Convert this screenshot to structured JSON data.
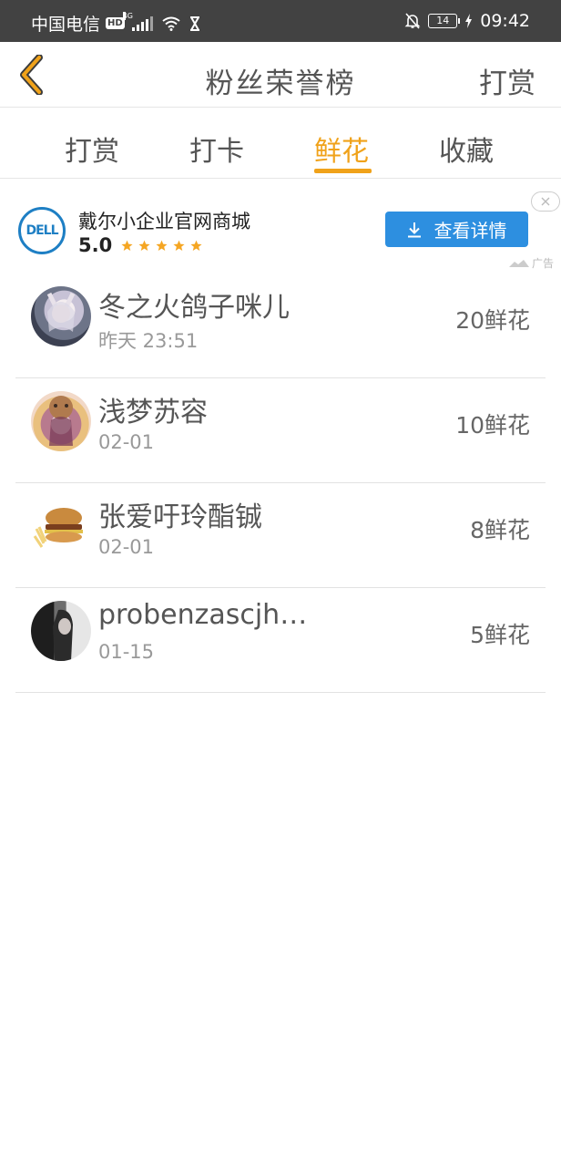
{
  "status_bar": {
    "carrier": "中国电信",
    "hd": "HD",
    "network": "4G",
    "battery": "14",
    "time": "09:42"
  },
  "header": {
    "title": "粉丝荣誉榜",
    "right_action": "打赏"
  },
  "tabs": [
    {
      "label": "打赏",
      "active": false
    },
    {
      "label": "打卡",
      "active": false
    },
    {
      "label": "鲜花",
      "active": true
    },
    {
      "label": "收藏",
      "active": false
    }
  ],
  "ad": {
    "logo_text": "DELL",
    "title": "戴尔小企业官网商城",
    "rating": "5.0",
    "stars": 5,
    "cta_label": "查看详情",
    "label": "广告"
  },
  "list": [
    {
      "name": "冬之火鸽子咪儿",
      "time": "昨天  23:51",
      "count": "20鲜花"
    },
    {
      "name": "浅梦苏容",
      "time": "02-01",
      "count": "10鲜花"
    },
    {
      "name": "张爱吁玲酯铖",
      "time": "02-01",
      "count": "8鲜花"
    },
    {
      "name": "probenzascjh…",
      "time": "01-15",
      "count": "5鲜花"
    }
  ],
  "colors": {
    "accent": "#f0a21a",
    "status_bar": "#424242",
    "ad_button": "#2d8fe0"
  }
}
